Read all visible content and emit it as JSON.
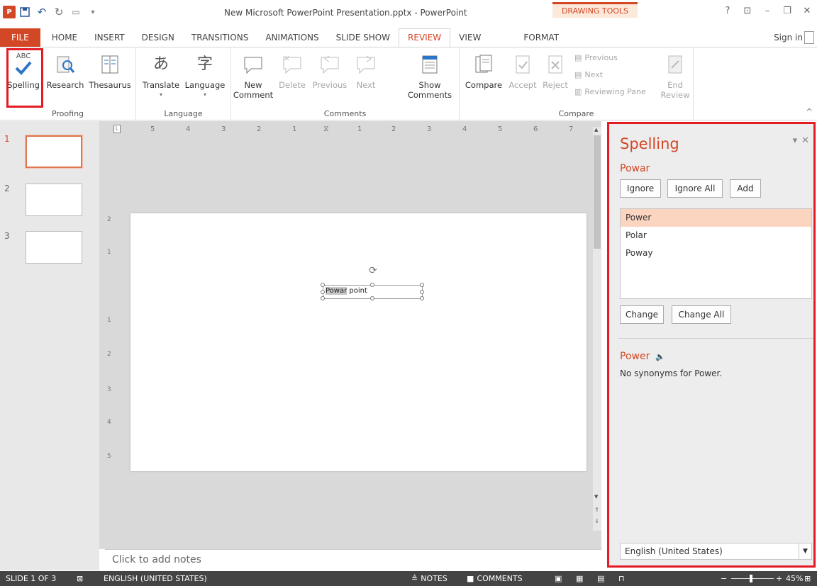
{
  "window": {
    "title": "New Microsoft PowerPoint Presentation.pptx - PowerPoint",
    "contextual_tab_group": "DRAWING TOOLS",
    "app_icon": "P"
  },
  "tabs": [
    {
      "label": "FILE"
    },
    {
      "label": "HOME"
    },
    {
      "label": "INSERT"
    },
    {
      "label": "DESIGN"
    },
    {
      "label": "TRANSITIONS"
    },
    {
      "label": "ANIMATIONS"
    },
    {
      "label": "SLIDE SHOW"
    },
    {
      "label": "REVIEW"
    },
    {
      "label": "VIEW"
    },
    {
      "label": "FORMAT"
    }
  ],
  "active_tab": "REVIEW",
  "signin": "Sign in",
  "ribbon": {
    "proofing": {
      "label": "Proofing",
      "spelling_icon_text": "ABC",
      "spelling": "Spelling",
      "research": "Research",
      "thesaurus": "Thesaurus"
    },
    "language": {
      "label": "Language",
      "translate": "Translate",
      "language": "Language"
    },
    "comments": {
      "label": "Comments",
      "new_comment_1": "New",
      "new_comment_2": "Comment",
      "delete": "Delete",
      "previous": "Previous",
      "next": "Next",
      "show_comments_1": "Show",
      "show_comments_2": "Comments"
    },
    "compare": {
      "label": "Compare",
      "compare": "Compare",
      "accept": "Accept",
      "reject": "Reject",
      "previous": "Previous",
      "next": "Next",
      "reviewing_pane": "Reviewing Pane",
      "end_review_1": "End",
      "end_review_2": "Review"
    }
  },
  "slides": [
    {
      "number": "1",
      "selected": true
    },
    {
      "number": "2",
      "selected": false
    },
    {
      "number": "3",
      "selected": false
    }
  ],
  "ruler": {
    "h_ticks": [
      "5",
      "4",
      "3",
      "2",
      "1",
      "1",
      "2",
      "3",
      "4",
      "5",
      "6",
      "7"
    ],
    "v_ticks": [
      "2",
      "1",
      "1",
      "2",
      "3",
      "4",
      "5"
    ]
  },
  "slide_text": {
    "misspelled": "Powar",
    "rest": " point"
  },
  "notes_placeholder": "Click to add notes",
  "spelling_pane": {
    "title": "Spelling",
    "misspelled_word": "Powar",
    "ignore": "Ignore",
    "ignore_all": "Ignore All",
    "add": "Add",
    "suggestions": [
      "Power",
      "Polar",
      "Poway"
    ],
    "change": "Change",
    "change_all": "Change All",
    "synonym_word": "Power",
    "synonym_text": "No synonyms for Power.",
    "language": "English (United States)"
  },
  "statusbar": {
    "slide_info": "SLIDE 1 OF 3",
    "language": "ENGLISH (UNITED STATES)",
    "notes": "NOTES",
    "comments": "COMMENTS",
    "zoom": "45%"
  },
  "colors": {
    "accent": "#d24726",
    "highlight_box": "#e41b23",
    "statusbar": "#444444"
  }
}
